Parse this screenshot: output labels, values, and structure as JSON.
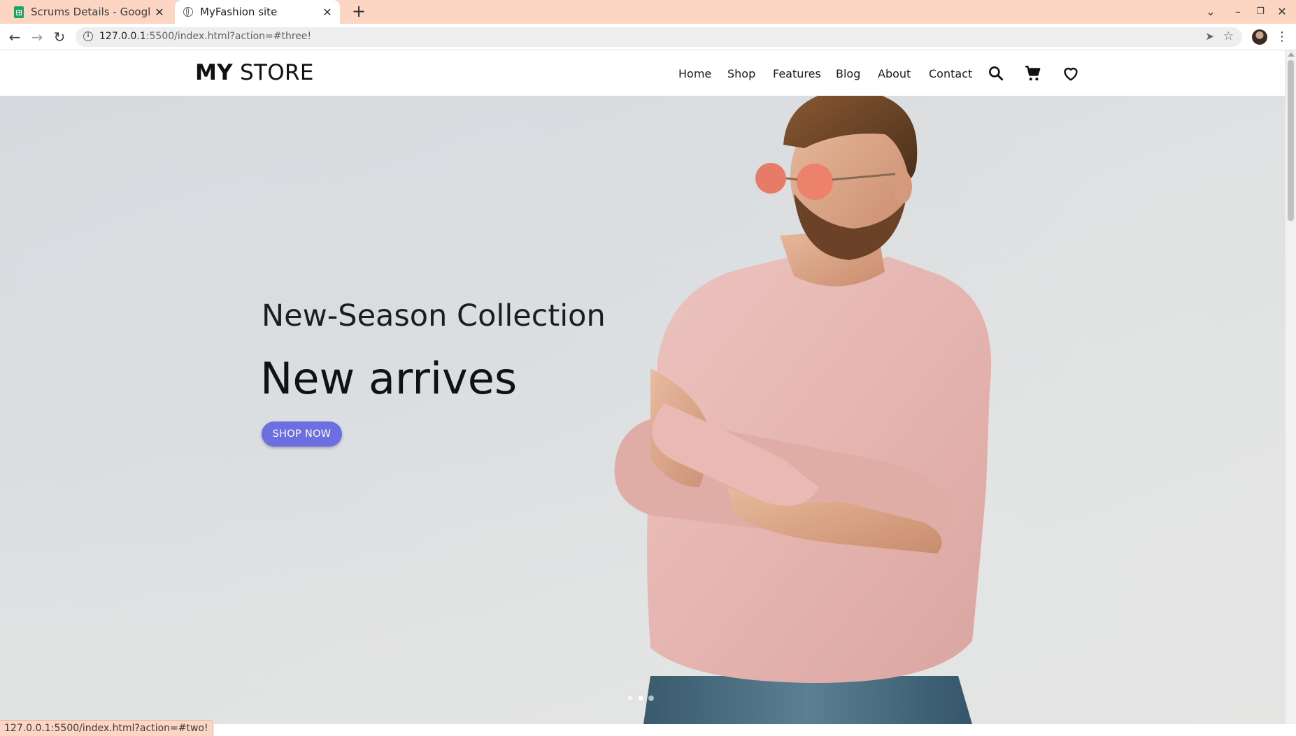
{
  "browser": {
    "tabs": [
      {
        "title": "Scrums Details - Google Sheets",
        "active": false,
        "favicon": "sheets-icon"
      },
      {
        "title": "MyFashion site",
        "active": true,
        "favicon": "globe-icon"
      }
    ],
    "new_tab_label": "+",
    "url_host": "127.0.0.1",
    "url_rest": ":5500/index.html?action=#three!",
    "status_url": "127.0.0.1:5500/index.html?action=#two!"
  },
  "site": {
    "logo_bold": "MY",
    "logo_rest": " STORE",
    "nav": [
      "Home",
      "Shop",
      "Features",
      "Blog",
      "About",
      "Contact"
    ],
    "header_icons": [
      "search-icon",
      "cart-icon",
      "heart-icon"
    ]
  },
  "hero": {
    "subtitle": "New-Season Collection",
    "title": "New arrives",
    "button_label": "SHOP NOW",
    "button_color": "#6b6fe0",
    "slides_count": 3,
    "active_slide": 2
  }
}
